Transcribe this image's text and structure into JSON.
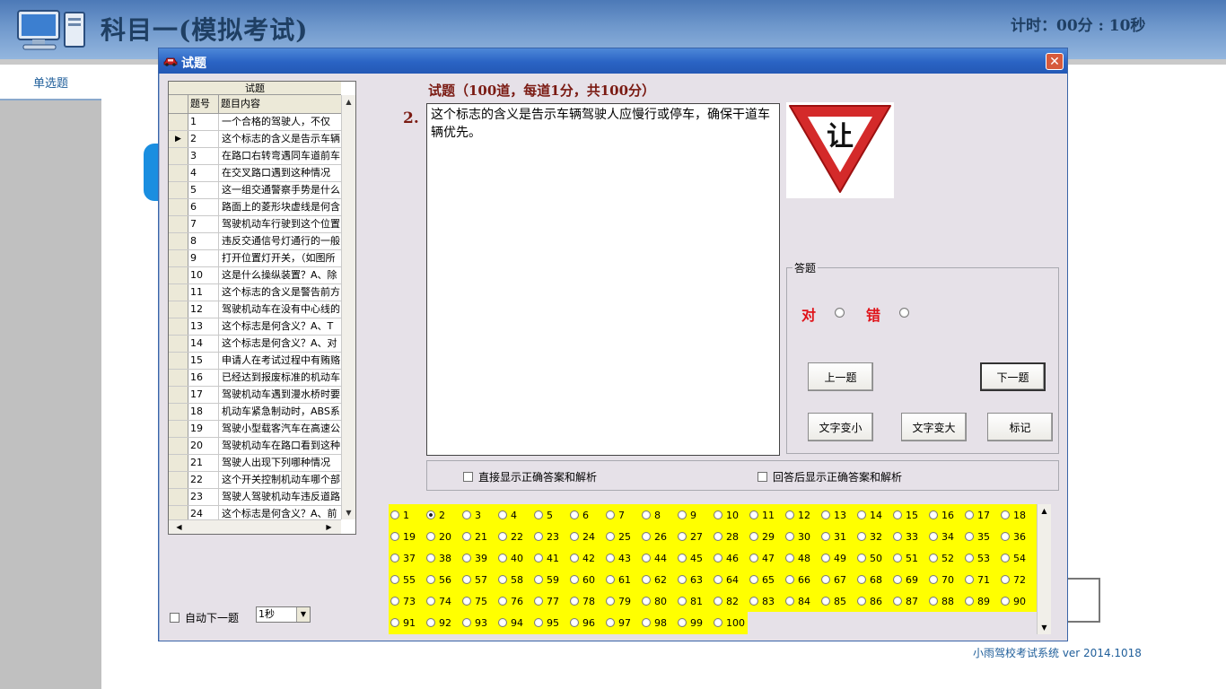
{
  "app": {
    "title": "科目一(模拟考试)",
    "timer": "计时：00分 : 10秒",
    "nav_tab": "单选题",
    "footer": "小雨驾校考试系统 ver 2014.1018"
  },
  "dialog": {
    "title": "试题",
    "close_symbol": "✕"
  },
  "question_list": {
    "caption": "试题",
    "col_no": "题号",
    "col_content": "题目内容",
    "current_row_marker": "▶",
    "rows": [
      {
        "no": "1",
        "text": "一个合格的驾驶人，不仅"
      },
      {
        "no": "2",
        "text": "这个标志的含义是告示车辆"
      },
      {
        "no": "3",
        "text": "在路口右转弯遇同车道前车"
      },
      {
        "no": "4",
        "text": "在交叉路口遇到这种情况"
      },
      {
        "no": "5",
        "text": "这一组交通警察手势是什么"
      },
      {
        "no": "6",
        "text": "路面上的菱形块虚线是何含"
      },
      {
        "no": "7",
        "text": "驾驶机动车行驶到这个位置"
      },
      {
        "no": "8",
        "text": "违反交通信号灯通行的一般"
      },
      {
        "no": "9",
        "text": "打开位置灯开关，（如图所"
      },
      {
        "no": "10",
        "text": "这是什么操纵装置？A、除"
      },
      {
        "no": "11",
        "text": "这个标志的含义是警告前方"
      },
      {
        "no": "12",
        "text": "驾驶机动车在没有中心线的"
      },
      {
        "no": "13",
        "text": "这个标志是何含义？A、T"
      },
      {
        "no": "14",
        "text": "这个标志是何含义？A、对"
      },
      {
        "no": "15",
        "text": "申请人在考试过程中有贿赂"
      },
      {
        "no": "16",
        "text": "已经达到报废标准的机动车"
      },
      {
        "no": "17",
        "text": "驾驶机动车遇到漫水桥时要"
      },
      {
        "no": "18",
        "text": "机动车紧急制动时，ABS系"
      },
      {
        "no": "19",
        "text": "驾驶小型载客汽车在高速公"
      },
      {
        "no": "20",
        "text": "驾驶机动车在路口看到这种"
      },
      {
        "no": "21",
        "text": "驾驶人出现下列哪种情况"
      },
      {
        "no": "22",
        "text": "这个开关控制机动车哪个部"
      },
      {
        "no": "23",
        "text": "驾驶人驾驶机动车违反道路"
      },
      {
        "no": "24",
        "text": "这个标志是何含义？A、前"
      }
    ]
  },
  "question": {
    "header": "试题（100道，每道1分，共100分）",
    "number": "2.",
    "text": " 这个标志的含义是告示车辆驾驶人应慢行或停车，确保干道车辆优先。",
    "sign_text": "让"
  },
  "answer": {
    "group_label": "答题",
    "true_label": "对",
    "false_label": "错",
    "prev_btn": "上一题",
    "next_btn": "下一题",
    "smaller_btn": "文字变小",
    "bigger_btn": "文字变大",
    "mark_btn": "标记"
  },
  "options": {
    "show_answer": "直接显示正确答案和解析",
    "show_after": "回答后显示正确答案和解析",
    "auto_next": "自动下一题",
    "interval": "1秒"
  },
  "grid": {
    "total": 100,
    "selected": 2
  },
  "colors": {
    "title_red": "#e0141a",
    "header_dark_red": "#7a1a12",
    "grid_yellow": "#ffff00",
    "titlebar_blue": "#2a63c4"
  }
}
